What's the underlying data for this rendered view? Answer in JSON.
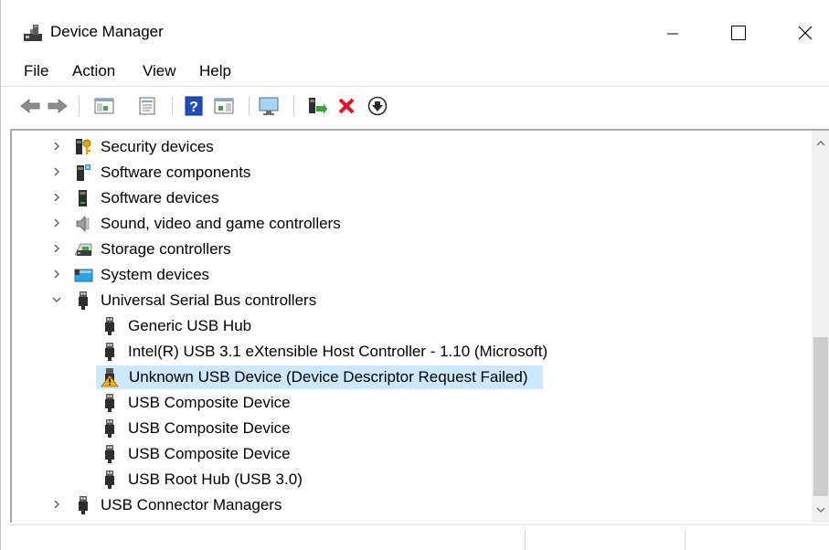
{
  "window": {
    "title": "Device Manager",
    "icon": "device-manager-icon"
  },
  "menu": [
    "File",
    "Action",
    "View",
    "Help"
  ],
  "toolbar": {
    "icons": [
      "back-arrow-icon",
      "forward-arrow-icon",
      "show-hide-console-tree-icon",
      "properties-icon",
      "help-icon",
      "action-pane-icon",
      "monitor-icon",
      "update-driver-icon",
      "uninstall-device-icon",
      "install-device-icon"
    ]
  },
  "tree": {
    "items": [
      {
        "label": "Security devices",
        "icon": "security-key-icon",
        "level": 0,
        "expanded": false
      },
      {
        "label": "Software components",
        "icon": "software-component-icon",
        "level": 0,
        "expanded": false
      },
      {
        "label": "Software devices",
        "icon": "software-device-icon",
        "level": 0,
        "expanded": false
      },
      {
        "label": "Sound, video and game controllers",
        "icon": "speaker-icon",
        "level": 0,
        "expanded": false
      },
      {
        "label": "Storage controllers",
        "icon": "storage-controller-icon",
        "level": 0,
        "expanded": false
      },
      {
        "label": "System devices",
        "icon": "system-device-icon",
        "level": 0,
        "expanded": false
      },
      {
        "label": "Universal Serial Bus controllers",
        "icon": "usb-plug-icon",
        "level": 0,
        "expanded": true
      },
      {
        "label": "Generic USB Hub",
        "icon": "usb-plug-icon",
        "level": 1
      },
      {
        "label": "Intel(R) USB 3.1 eXtensible Host Controller - 1.10 (Microsoft)",
        "icon": "usb-plug-icon",
        "level": 1
      },
      {
        "label": "Unknown USB Device (Device Descriptor Request Failed)",
        "icon": "usb-warning-icon",
        "level": 1,
        "selected": true
      },
      {
        "label": "USB Composite Device",
        "icon": "usb-plug-icon",
        "level": 1
      },
      {
        "label": "USB Composite Device",
        "icon": "usb-plug-icon",
        "level": 1
      },
      {
        "label": "USB Composite Device",
        "icon": "usb-plug-icon",
        "level": 1
      },
      {
        "label": "USB Root Hub (USB 3.0)",
        "icon": "usb-plug-icon",
        "level": 1
      },
      {
        "label": "USB Connector Managers",
        "icon": "usb-plug-icon",
        "level": 0,
        "expanded": false
      }
    ]
  },
  "colors": {
    "selection": "#cce8ff",
    "warning": "#f2b600",
    "uninstall": "#e81123",
    "help": "#1c4ec2"
  }
}
